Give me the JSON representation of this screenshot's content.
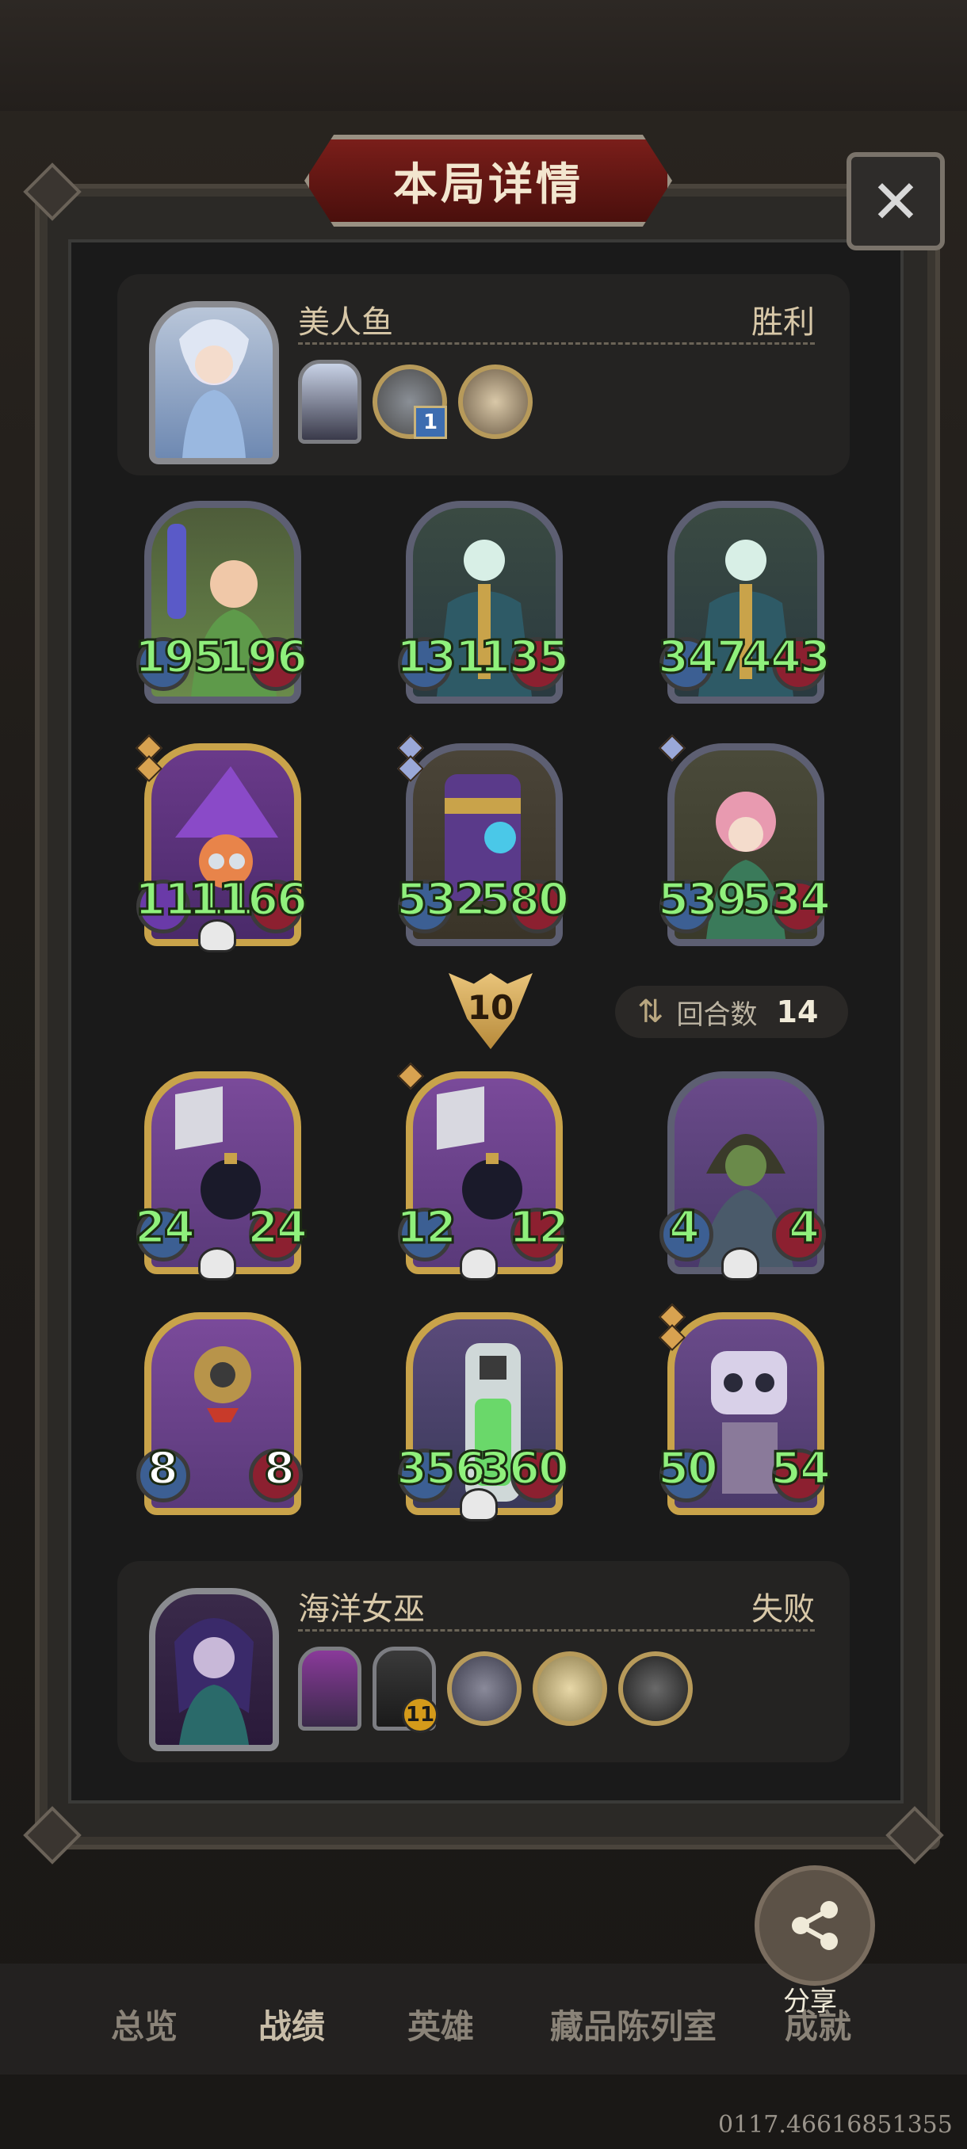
{
  "dialog": {
    "title": "本局详情",
    "close_icon": "close-icon"
  },
  "top_player": {
    "name": "美人鱼",
    "result": "胜利",
    "items": [
      {
        "kind": "card",
        "name": "shadow-card-icon"
      },
      {
        "kind": "coin",
        "name": "key-coin-icon",
        "badge": "1"
      },
      {
        "kind": "coin",
        "name": "scroll-coin-icon"
      }
    ]
  },
  "top_units": [
    {
      "name": "herb-druid",
      "attack": "195",
      "health": "196",
      "frame": "silver",
      "gems": []
    },
    {
      "name": "chain-lich",
      "attack": "131",
      "health": "135",
      "frame": "silver",
      "gems": []
    },
    {
      "name": "chain-lich",
      "attack": "347",
      "health": "443",
      "frame": "silver",
      "gems": []
    },
    {
      "name": "goggle-witch",
      "attack": "1111",
      "health": "1166",
      "frame": "gold",
      "gems": [
        "gold",
        "gold"
      ],
      "skull": true
    },
    {
      "name": "gold-cannon",
      "attack": "532",
      "health": "580",
      "frame": "silver",
      "gems": [
        "blue",
        "blue"
      ]
    },
    {
      "name": "vine-sorceress",
      "attack": "539",
      "health": "534",
      "frame": "silver",
      "gems": [
        "blue"
      ]
    }
  ],
  "round": {
    "marker": "10",
    "label": "回合数",
    "value": "14"
  },
  "bottom_units": [
    {
      "name": "bomb-knight",
      "attack": "24",
      "health": "24",
      "frame": "gold",
      "gems": [],
      "skull": true
    },
    {
      "name": "bomb-knight",
      "attack": "12",
      "health": "12",
      "frame": "gold",
      "gems": [
        "gold"
      ],
      "skull": true
    },
    {
      "name": "hooded-goblin",
      "attack": "4",
      "health": "4",
      "frame": "silver",
      "gems": [],
      "skull": true
    },
    {
      "name": "diver-bot",
      "attack": "8",
      "health": "8",
      "frame": "gold",
      "gems": []
    },
    {
      "name": "tank-machine",
      "attack": "356",
      "health": "360",
      "frame": "gold",
      "gems": [],
      "skull": true
    },
    {
      "name": "mech-golem",
      "attack": "50",
      "health": "54",
      "frame": "gold",
      "gems": [
        "gold",
        "gold"
      ]
    }
  ],
  "bottom_player": {
    "name": "海洋女巫",
    "result": "失败",
    "items": [
      {
        "kind": "card",
        "name": "jellyfish-card-icon"
      },
      {
        "kind": "card",
        "name": "hood-card-icon",
        "badge": "11"
      },
      {
        "kind": "coin",
        "name": "goblin-coin-icon"
      },
      {
        "kind": "coin",
        "name": "potion-coin-icon"
      },
      {
        "kind": "coin",
        "name": "reaper-coin-icon"
      }
    ]
  },
  "share": {
    "label": "分享"
  },
  "tabs": [
    {
      "label": "总览",
      "active": false
    },
    {
      "label": "战绩",
      "active": true
    },
    {
      "label": "英雄",
      "active": false
    },
    {
      "label": "藏品陈列室",
      "active": false
    },
    {
      "label": "成就",
      "active": false
    }
  ],
  "version": "0117.46616851355",
  "colors": {
    "stat": "#8ff07c",
    "title_bg": "#6a1815",
    "panel": "#1a1a1a"
  }
}
